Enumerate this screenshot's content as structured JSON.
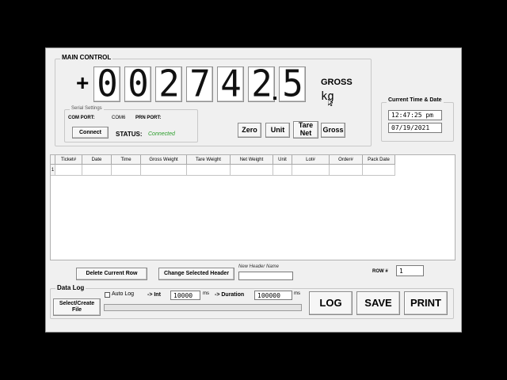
{
  "main_control": {
    "title": "MAIN CONTROL",
    "sign": "+",
    "digits": [
      "0",
      "0",
      "2",
      "7",
      "4",
      "2",
      "5"
    ],
    "mode": "GROSS",
    "unit": "kg"
  },
  "serial": {
    "title": "Serial Settings",
    "com_port_label": "COM PORT:",
    "com_port_value": "COM6",
    "prn_port_label": "PRN PORT:",
    "connect_label": "Connect",
    "status_label": "STATUS:",
    "status_value": "Connected",
    "status_color": "#2a9d2a"
  },
  "scale_buttons": {
    "zero": "Zero",
    "unit": "Unit",
    "tare_net_1": "Tare",
    "tare_net_2": "Net",
    "gross": "Gross"
  },
  "clock": {
    "title": "Current Time & Date",
    "time": "12:47:25 pm",
    "date": "07/19/2021"
  },
  "table": {
    "columns": [
      "Ticket#",
      "Date",
      "Time",
      "Gross Weight",
      "Tare Weight",
      "Net Weight",
      "Unit",
      "Lot#",
      "Order#",
      "Pack Date"
    ],
    "row_number": "1"
  },
  "controls": {
    "delete_row": "Delete Current Row",
    "change_header": "Change Selected Header",
    "new_header_label": "New Header Name",
    "new_header_value": "",
    "row_label": "ROW #",
    "row_value": "1"
  },
  "data_log": {
    "title": "Data Log",
    "select_file_1": "Select/Create",
    "select_file_2": "File",
    "auto_log": "Auto Log",
    "int_label": "-> Int",
    "int_value": "10000",
    "ms_1": "ms",
    "duration_label": "-> Duration",
    "duration_value": "100000",
    "ms_2": "ms",
    "log": "LOG",
    "save": "SAVE",
    "print": "PRINT"
  }
}
